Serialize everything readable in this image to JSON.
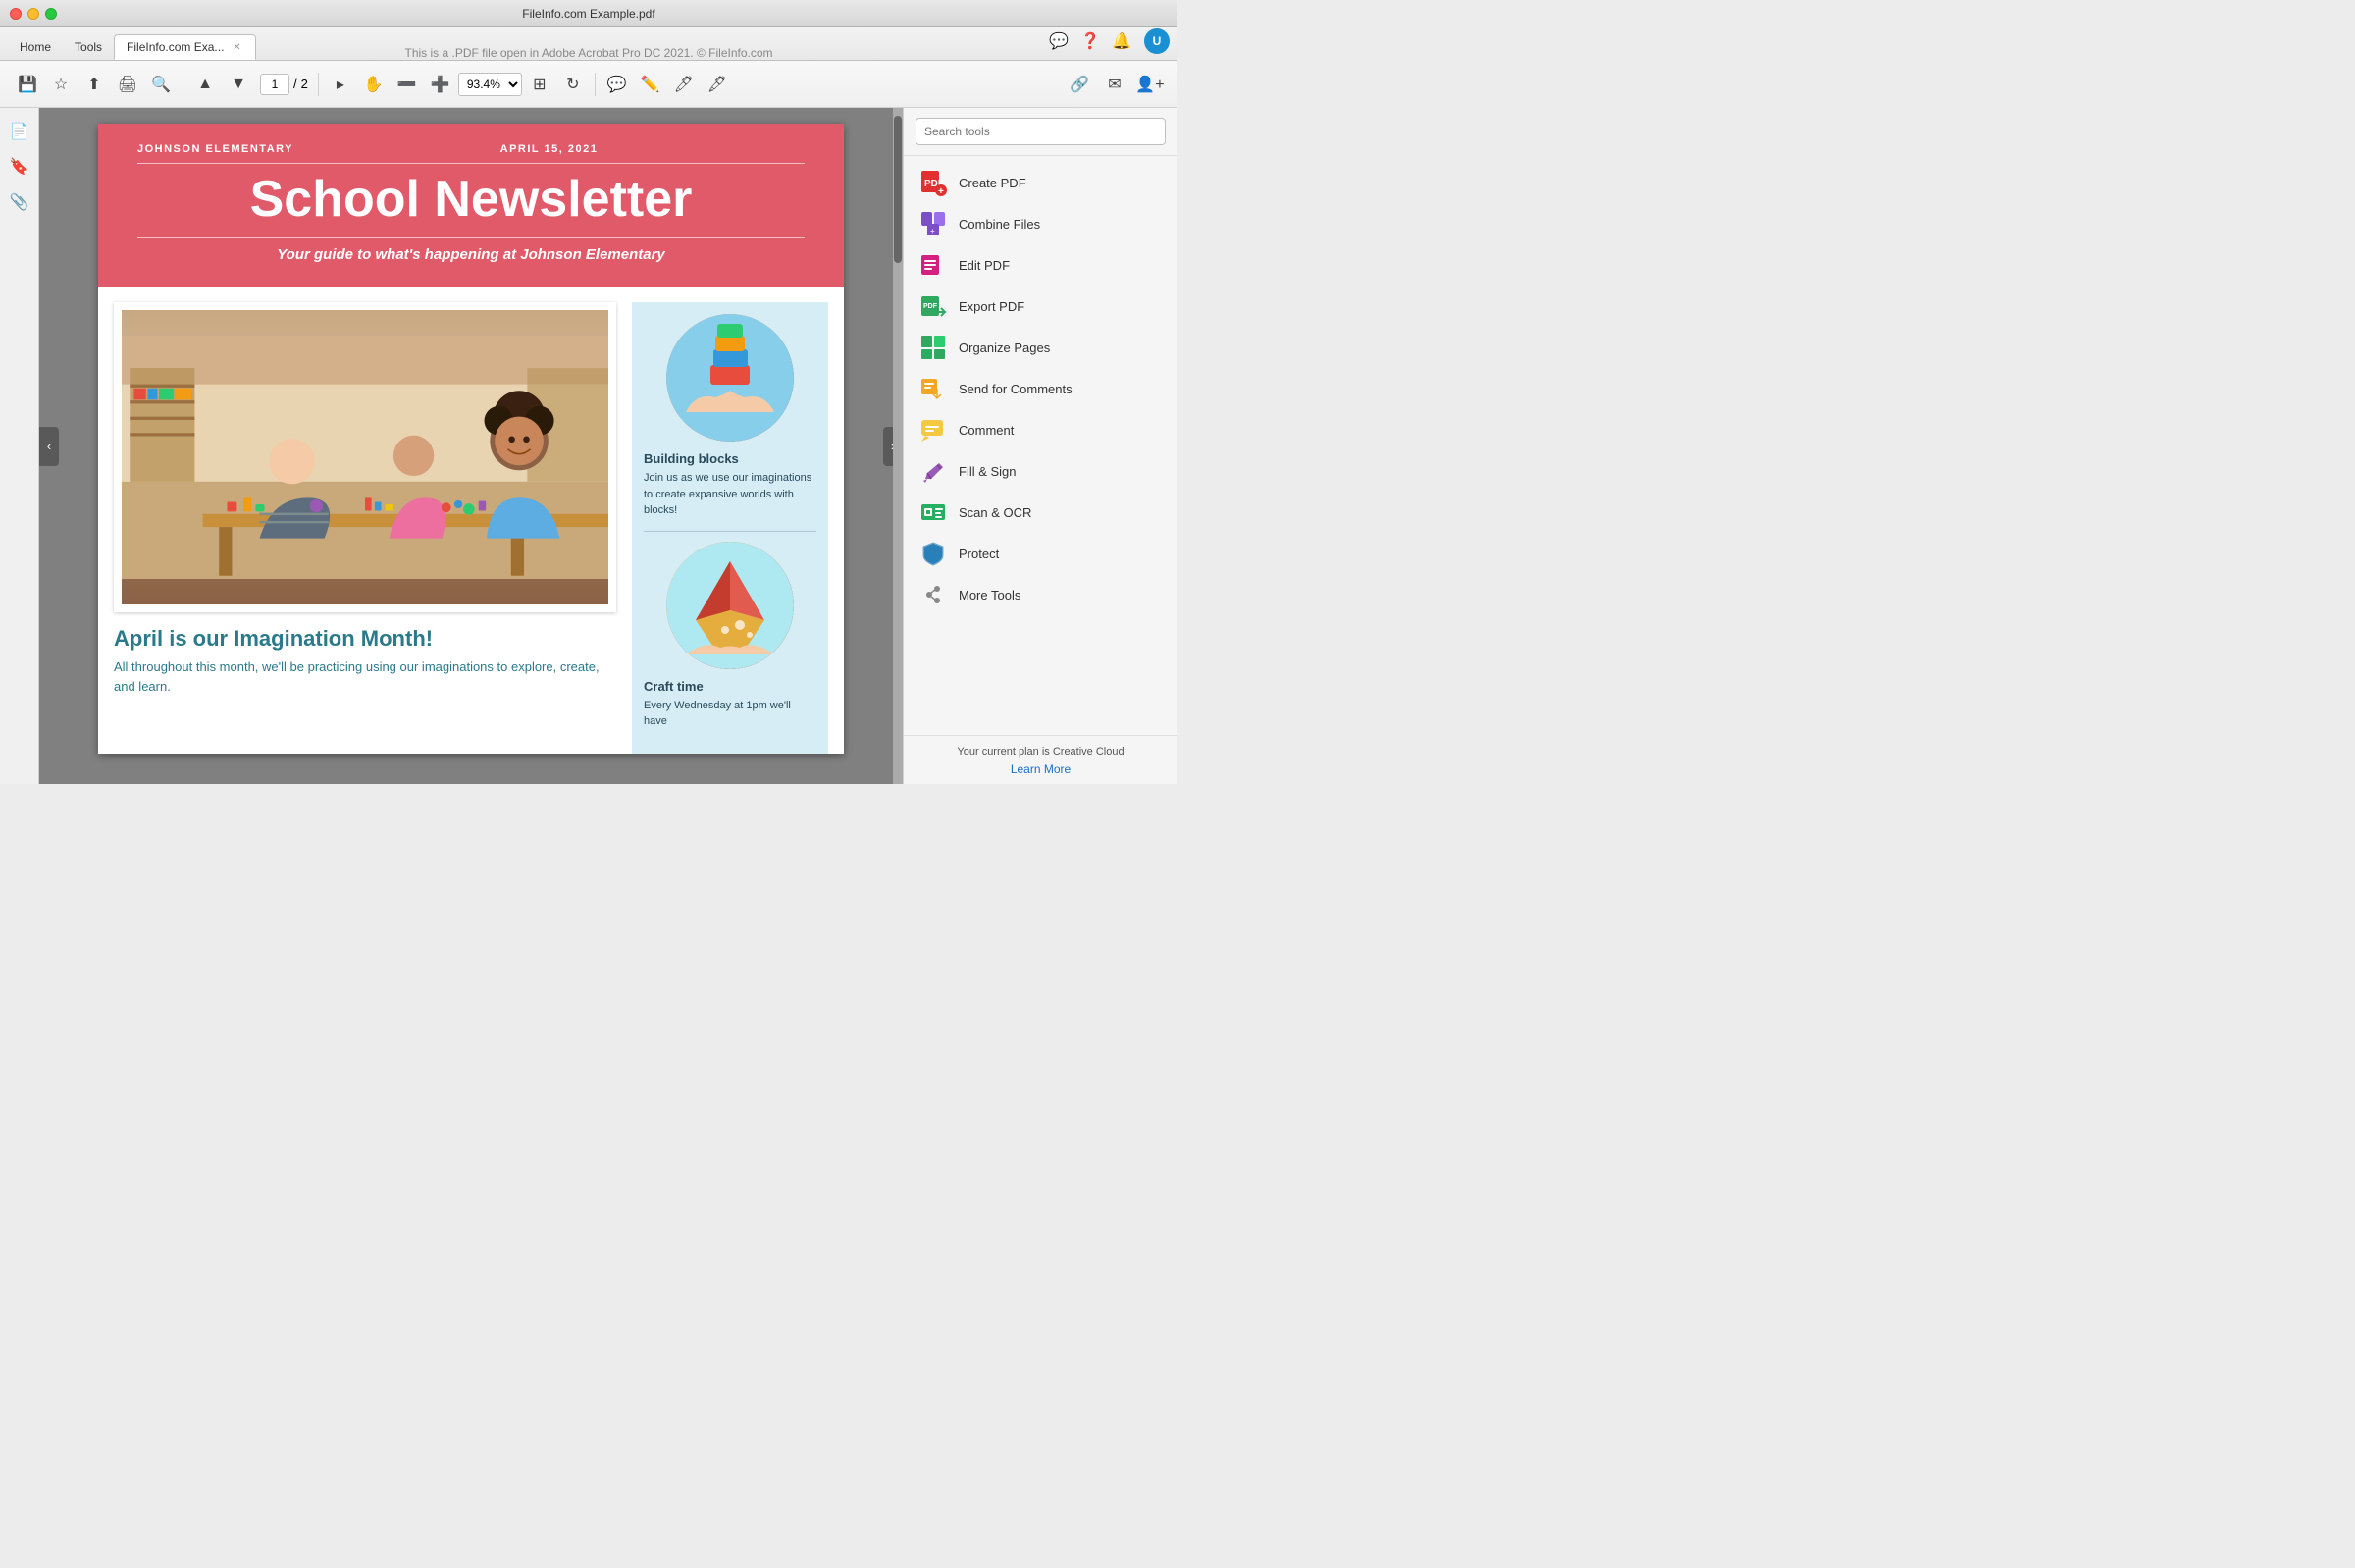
{
  "window": {
    "title": "FileInfo.com Example.pdf",
    "tab_label": "FileInfo.com Exa...",
    "center_text": "This is a .PDF file open in Adobe Acrobat Pro DC 2021. © FileInfo.com"
  },
  "nav_tabs": [
    {
      "id": "home",
      "label": "Home"
    },
    {
      "id": "tools",
      "label": "Tools"
    },
    {
      "id": "file",
      "label": "FileInfo.com Exa...",
      "active": true
    }
  ],
  "toolbar": {
    "page_current": "1",
    "page_total": "2",
    "zoom_value": "93.4%"
  },
  "pdf": {
    "newsletter": {
      "school": "JOHNSON ELEMENTARY",
      "date": "APRIL 15, 2021",
      "title": "School Newsletter",
      "subtitle": "Your guide to what's happening at Johnson Elementary",
      "main_article": {
        "heading": "April is our Imagination Month!",
        "body": "All throughout this month, we'll be practicing using our imaginations to explore, create, and learn."
      },
      "sidebar_section1": {
        "title": "Building blocks",
        "body": "Join us as we use our imaginations to create expansive worlds with blocks!"
      },
      "sidebar_section2": {
        "title": "Craft time",
        "body": "Every Wednesday at 1pm we'll have"
      }
    }
  },
  "right_panel": {
    "search_placeholder": "Search tools",
    "tools": [
      {
        "id": "create-pdf",
        "label": "Create PDF",
        "color": "#e03030",
        "icon": "📄"
      },
      {
        "id": "combine-files",
        "label": "Combine Files",
        "color": "#7b4fc9",
        "icon": "🗂"
      },
      {
        "id": "edit-pdf",
        "label": "Edit PDF",
        "color": "#d42080",
        "icon": "✏️"
      },
      {
        "id": "export-pdf",
        "label": "Export PDF",
        "color": "#30a860",
        "icon": "📤"
      },
      {
        "id": "organize-pages",
        "label": "Organize Pages",
        "color": "#30a860",
        "icon": "🗄"
      },
      {
        "id": "send-for-comments",
        "label": "Send for Comments",
        "color": "#f5a623",
        "icon": "💬"
      },
      {
        "id": "comment",
        "label": "Comment",
        "color": "#f5c842",
        "icon": "🗨"
      },
      {
        "id": "fill-sign",
        "label": "Fill & Sign",
        "color": "#9b59b6",
        "icon": "✒️"
      },
      {
        "id": "scan-ocr",
        "label": "Scan & OCR",
        "color": "#27ae60",
        "icon": "🖨"
      },
      {
        "id": "protect",
        "label": "Protect",
        "color": "#2980b9",
        "icon": "🛡"
      },
      {
        "id": "more-tools",
        "label": "More Tools",
        "color": "#555",
        "icon": "🔧"
      }
    ],
    "footer": {
      "plan_text": "Your current plan is Creative Cloud",
      "learn_more": "Learn More"
    }
  }
}
